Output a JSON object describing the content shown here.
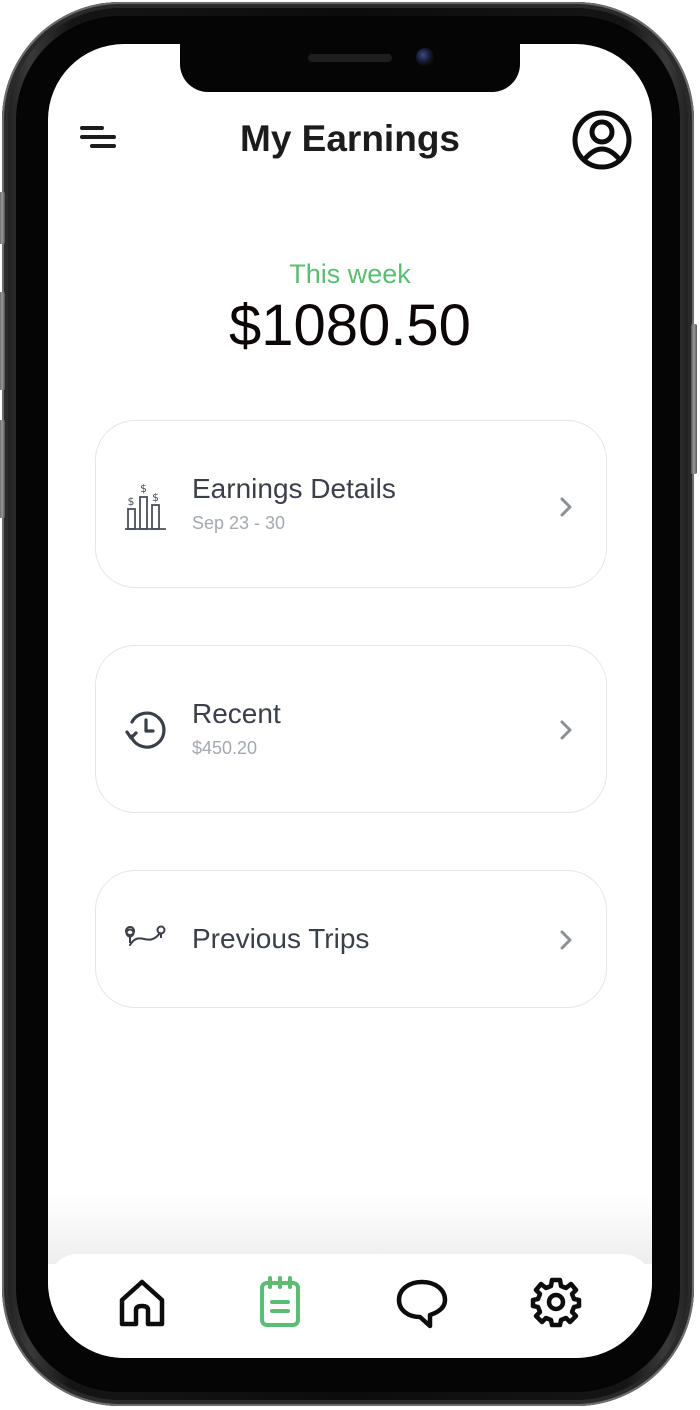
{
  "header": {
    "title": "My Earnings",
    "menu_icon": "menu-icon",
    "profile_icon": "user-circle-icon"
  },
  "summary": {
    "period_label": "This week",
    "amount": "$1080.50"
  },
  "cards": [
    {
      "title": "Earnings Details",
      "subtitle": "Sep 23 - 30",
      "icon": "earnings-chart-icon"
    },
    {
      "title": "Recent",
      "subtitle": "$450.20",
      "icon": "history-clock-icon"
    },
    {
      "title": "Previous Trips",
      "subtitle": "",
      "icon": "route-icon"
    }
  ],
  "tabbar": {
    "items": [
      {
        "name": "home",
        "icon": "home-icon",
        "active": false
      },
      {
        "name": "earnings",
        "icon": "notepad-icon",
        "active": true
      },
      {
        "name": "messages",
        "icon": "chat-bubble-icon",
        "active": false
      },
      {
        "name": "settings",
        "icon": "gear-icon",
        "active": false
      }
    ]
  },
  "colors": {
    "accent_green": "#5bbd72",
    "text_dark": "#1c1c1c",
    "card_title": "#3a3f4a",
    "card_subtitle": "#a4a8b0"
  }
}
